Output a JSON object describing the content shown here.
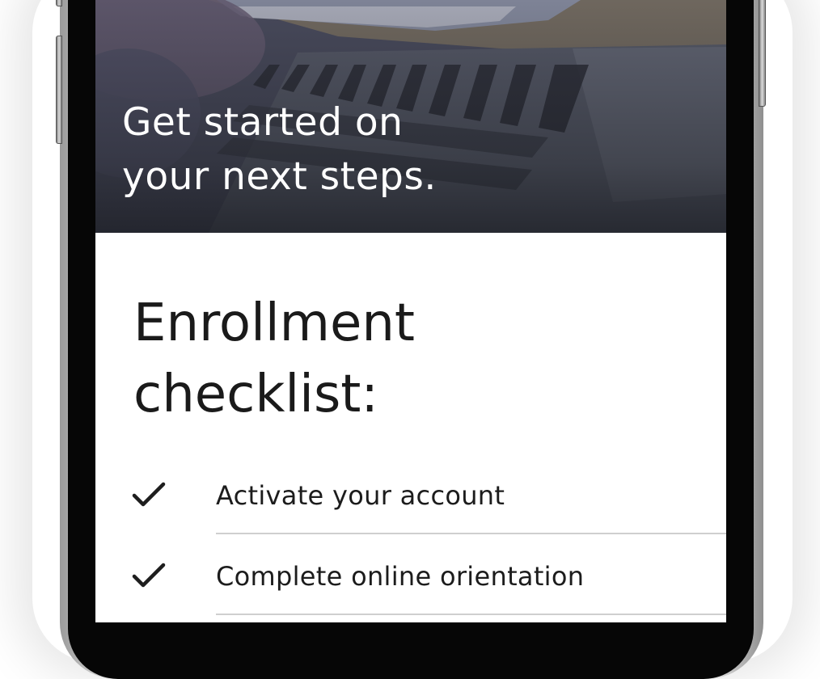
{
  "hero": {
    "title_line1": "Get started on",
    "title_line2": "your next steps."
  },
  "checklist": {
    "title_line1": "Enrollment",
    "title_line2": "checklist:",
    "items": [
      {
        "label": "Activate your account",
        "icon": "checkmark-icon",
        "checked": true
      },
      {
        "label": "Complete online orientation",
        "icon": "checkmark-icon",
        "checked": true
      }
    ]
  },
  "colors": {
    "text": "#1a1a1a",
    "hero_text": "#ffffff",
    "divider": "#cfcfcf"
  }
}
